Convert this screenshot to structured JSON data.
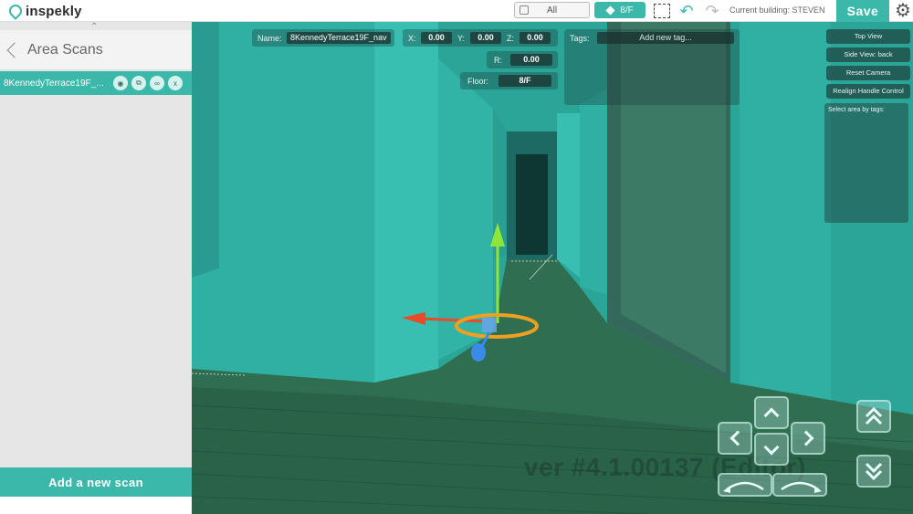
{
  "topbar": {
    "logo_text": "inspekly",
    "filter_all_label": "All",
    "floor_toggle_label": "8/F",
    "current_building": "Current building: STEVEN",
    "save_label": "Save"
  },
  "sidebar": {
    "title": "Area Scans",
    "scans": [
      {
        "name": "8KennedyTerrace19F_...",
        "actions": [
          "eye-icon",
          "copy-icon",
          "link-icon",
          "x"
        ]
      }
    ],
    "add_scan_label": "Add a new scan"
  },
  "viewport": {
    "name_label": "Name:",
    "name_value": "8KennedyTerrace19F_nav",
    "x_label": "X:",
    "x_value": "0.00",
    "y_label": "Y:",
    "y_value": "0.00",
    "z_label": "Z:",
    "z_value": "0.00",
    "r_label": "R:",
    "r_value": "0.00",
    "floor_label": "Floor:",
    "floor_value": "8/F",
    "tags_label": "Tags:",
    "tags_placeholder": "Add new tag...",
    "buttons": {
      "top_view": "Top View",
      "side_view": "Side View: back",
      "reset_camera": "Reset Camera",
      "realign": "Realign Handle Control"
    },
    "select_by_tags": "Select area by tags:",
    "version": "ver #4.1.00137 (Editor)"
  },
  "colors": {
    "accent": "#3bb8aa",
    "scene_wall": "#2fb5a7",
    "floor_wood": "#2f6e50",
    "gizmo_y": "#8ee63a",
    "gizmo_x": "#e84a2a",
    "gizmo_ring": "#f0a020",
    "gizmo_z": "#3a8ae8"
  }
}
